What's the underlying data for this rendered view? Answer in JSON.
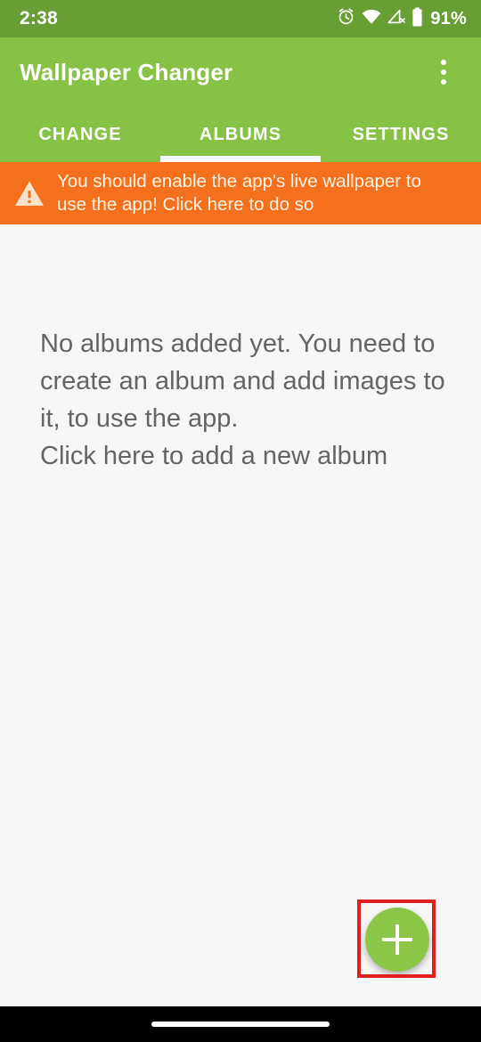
{
  "status_bar": {
    "time": "2:38",
    "battery_percent": "91%",
    "icons": [
      "alarm-icon",
      "wifi-icon",
      "cellular-no-service-icon",
      "battery-icon"
    ],
    "background_color": "#679f35"
  },
  "app_bar": {
    "title": "Wallpaper Changer",
    "overflow_label": "More options",
    "background_color": "#85c246"
  },
  "tabs": {
    "items": [
      {
        "label": "CHANGE",
        "active": false
      },
      {
        "label": "ALBUMS",
        "active": true
      },
      {
        "label": "SETTINGS",
        "active": false
      }
    ],
    "indicator_color": "#ffffff"
  },
  "warning_banner": {
    "icon": "warning-triangle-icon",
    "line1": "You should enable the app's live wallpaper to",
    "line2": "use the app! Click here to do so",
    "background_color": "#f4701c",
    "text_color": "#fdf3e3"
  },
  "empty_state": {
    "line1": "No albums added yet. You need to",
    "line2": "create an album and add images to",
    "line3": "it, to use the app.",
    "line4": "Click here to add a new album",
    "text_color": "#646464"
  },
  "fab": {
    "icon": "plus-icon",
    "label": "Add album",
    "background_color": "#8cc649",
    "highlight_color": "#e02020"
  },
  "nav_bar": {
    "gesture_pill_label": "home-gesture-pill",
    "background_color": "#000000"
  }
}
